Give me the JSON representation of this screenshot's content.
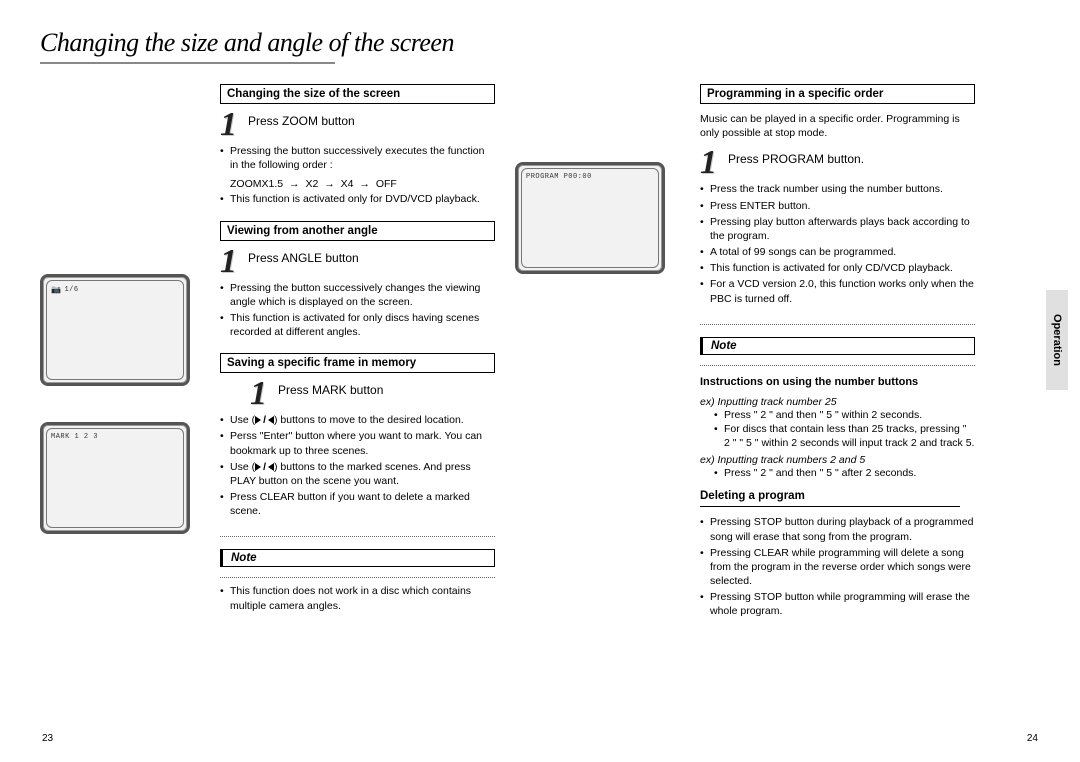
{
  "title": "Changing the size and angle of the screen",
  "side_tab": "Operation",
  "page_left": "23",
  "page_right": "24",
  "screens": {
    "angle_osd": "1/6",
    "mark_osd": "MARK 1 2 3",
    "program_osd": "PROGRAM P00:00"
  },
  "left": {
    "sec1": {
      "heading": "Changing the size of the screen",
      "step": "Press ZOOM button",
      "bullets": [
        "Pressing the button successively executes the function in the following order :"
      ],
      "zoom_seq": [
        "ZOOMX1.5",
        "X2",
        "X4",
        "OFF"
      ],
      "bullets2": [
        "This function is activated only for DVD/VCD playback."
      ]
    },
    "sec2": {
      "heading": "Viewing from another angle",
      "step": "Press ANGLE button",
      "bullets": [
        "Pressing the button successively changes the viewing angle which is displayed on the screen.",
        "This function is activated for only discs having scenes recorded at different angles."
      ]
    },
    "sec3": {
      "heading": "Saving a specific frame in memory",
      "step": "Press MARK button",
      "b1_pre": "Use (",
      "b1_post": ") buttons to move to the desired location.",
      "b2": "Perss \"Enter\" button where you want to mark. You can bookmark up to three scenes.",
      "b3_pre": "Use (",
      "b3_post": ") buttons to the marked scenes. And press PLAY button on the scene you want.",
      "b4": "Press CLEAR button if you want to delete a marked scene."
    },
    "note": {
      "label": "Note",
      "bullets": [
        "This function does not work in a disc which contains multiple camera angles."
      ]
    }
  },
  "right": {
    "sec1": {
      "heading": "Programming in a specific order",
      "intro": "Music can be played in a specific order. Programming is only possible at stop mode.",
      "step": "Press PROGRAM button.",
      "bullets": [
        "Press the track number using the number buttons.",
        "Press ENTER button.",
        "Pressing play button afterwards plays back according to the program.",
        "A total of 99 songs can be programmed.",
        "This function is activated for only CD/VCD playback.",
        "For a VCD version 2.0, this function works only when the PBC is turned off."
      ]
    },
    "note": {
      "label": "Note",
      "heading": "Instructions on using the number buttons",
      "ex1": "ex) Inputting track number 25",
      "ex1_bullets": [
        "Press \" 2 \" and then \" 5 \" within 2 seconds.",
        "For discs that contain less than 25 tracks, pressing \" 2 \" \" 5 \" within 2 seconds will input track 2 and track 5."
      ],
      "ex2": "ex) Inputting track numbers 2 and 5",
      "ex2_bullets": [
        "Press \" 2 \" and then \" 5 \" after 2 seconds."
      ]
    },
    "sec2": {
      "heading": "Deleting a program",
      "bullets": [
        "Pressing STOP button during playback of a programmed song will erase that song from the program.",
        "Pressing CLEAR while programming will delete a song from the program in the reverse order which songs were selected.",
        "Pressing STOP button while programming will erase the whole program."
      ]
    }
  }
}
